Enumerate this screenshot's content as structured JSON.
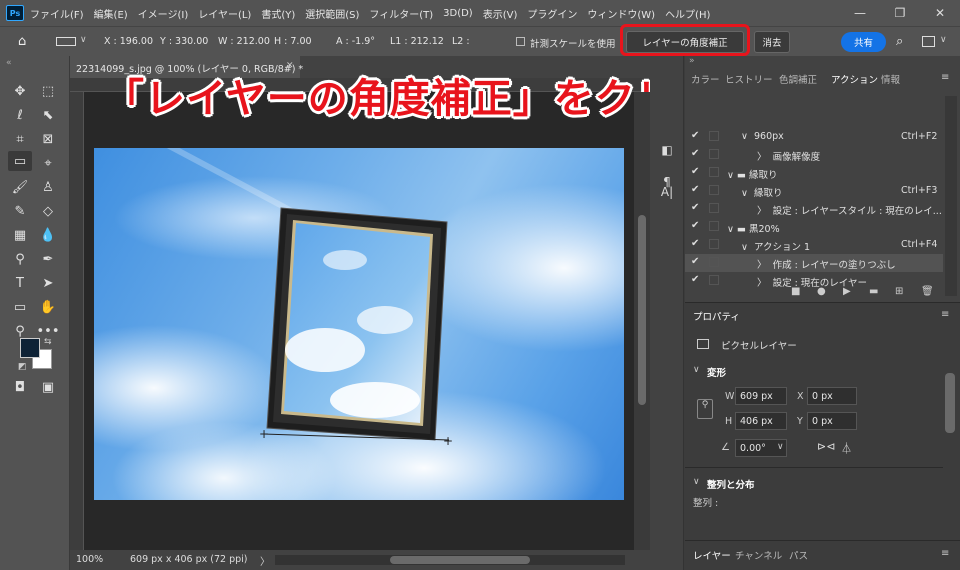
{
  "menubar": {
    "items": [
      "ファイル(F)",
      "編集(E)",
      "イメージ(I)",
      "レイヤー(L)",
      "書式(Y)",
      "選択範囲(S)",
      "フィルター(T)",
      "3D(D)",
      "表示(V)",
      "プラグイン",
      "ウィンドウ(W)",
      "ヘルプ(H)"
    ],
    "app_icon": "Ps"
  },
  "options": {
    "x": "X : 196.00",
    "y": "Y : 330.00",
    "w": "W : 212.00",
    "h": "H : 7.00",
    "a": "A : -1.9°",
    "l1": "L1 : 212.12",
    "l2": "L2 :",
    "use_measurement_scale": "計測スケールを使用",
    "straighten_label": "レイヤーの角度補正",
    "clear_label": "消去",
    "share_label": "共有"
  },
  "document": {
    "tab_title": "22314099_s.jpg @ 100% (レイヤー 0, RGB/8#) *",
    "zoom": "100%",
    "size_info": "609 px x 406 px (72 ppi)"
  },
  "caption": "「レイヤーの角度補正」をクリック",
  "panel_tabs": [
    "カラー",
    "ヒストリー",
    "色調補正",
    "アクション",
    "情報"
  ],
  "actions": [
    {
      "indent": 2,
      "label": "960px",
      "shortcut": "Ctrl+F2",
      "arrow": "∨"
    },
    {
      "indent": 3,
      "label": "画像解像度",
      "shortcut": "",
      "arrow": "〉"
    },
    {
      "indent": 1,
      "label": "縁取り",
      "shortcut": "",
      "arrow": "∨",
      "folder": true
    },
    {
      "indent": 2,
      "label": "縁取り",
      "shortcut": "Ctrl+F3",
      "arrow": "∨"
    },
    {
      "indent": 3,
      "label": "設定 : レイヤースタイル : 現在のレイ...",
      "shortcut": "",
      "arrow": "〉"
    },
    {
      "indent": 1,
      "label": "黒20%",
      "shortcut": "",
      "arrow": "∨",
      "folder": true
    },
    {
      "indent": 2,
      "label": "アクション 1",
      "shortcut": "Ctrl+F4",
      "arrow": "∨"
    },
    {
      "indent": 3,
      "label": "作成 : レイヤーの塗りつぶし",
      "shortcut": "",
      "arrow": "〉",
      "selected": true
    },
    {
      "indent": 3,
      "label": "設定 : 現在のレイヤー",
      "shortcut": "",
      "arrow": "〉"
    }
  ],
  "properties": {
    "tab": "プロパティ",
    "layer_type": "ピクセルレイヤー",
    "transform_title": "変形",
    "w_label": "W",
    "w_value": "609 px",
    "h_label": "H",
    "h_value": "406 px",
    "x_label": "X",
    "x_value": "0 px",
    "y_label": "Y",
    "y_value": "0 px",
    "angle_value": "0.00°",
    "align_title": "整列と分布",
    "align_label": "整列 :"
  },
  "bottom_tabs": [
    "レイヤー",
    "チャンネル",
    "パス"
  ],
  "colors": {
    "highlight": "#e8141c",
    "share": "#1473e6"
  }
}
